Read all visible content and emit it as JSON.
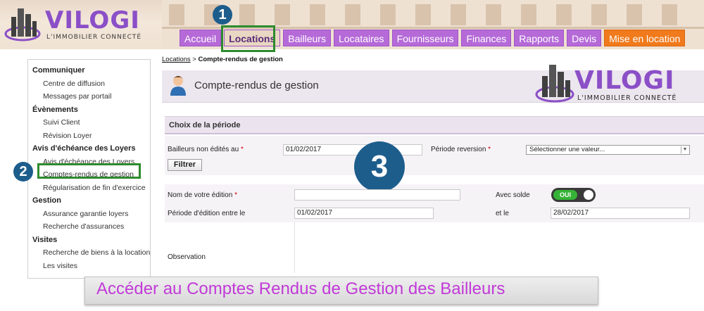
{
  "header": {
    "logo": {
      "name": "VILOGI",
      "tagline": "L'IMMOBILIER CONNECTÉ"
    },
    "nav": [
      {
        "label": "Accueil",
        "state": "normal"
      },
      {
        "label": "Locations",
        "state": "active"
      },
      {
        "label": "Bailleurs",
        "state": "normal"
      },
      {
        "label": "Locataires",
        "state": "normal"
      },
      {
        "label": "Fournisseurs",
        "state": "normal"
      },
      {
        "label": "Finances",
        "state": "normal"
      },
      {
        "label": "Rapports",
        "state": "normal"
      },
      {
        "label": "Devis",
        "state": "normal"
      },
      {
        "label": "Mise en location",
        "state": "highlight"
      }
    ]
  },
  "badges": {
    "one": "1",
    "two": "2",
    "three": "3"
  },
  "sidebar": {
    "sections": [
      {
        "title": "Communiquer",
        "items": [
          "Centre de diffusion",
          "Messages par portail"
        ]
      },
      {
        "title": "Évènements",
        "items": [
          "Suivi Client",
          "Révision Loyer"
        ]
      },
      {
        "title": "Avis d'échéance des Loyers",
        "items": [
          "Avis d'échéance des Loyers",
          "Comptes-rendus de gestion",
          "Régularisation de fin d'exercice"
        ]
      },
      {
        "title": "Gestion",
        "items": [
          "Assurance garantie loyers",
          "Recherche d'assurances"
        ]
      },
      {
        "title": "Visites",
        "items": [
          "Recherche de biens à la location",
          "Les visites"
        ]
      }
    ]
  },
  "breadcrumb": {
    "parent": "Locations",
    "separator": " > ",
    "current": "Compte-rendus de gestion"
  },
  "panel": {
    "title": "Compte-rendus de gestion"
  },
  "logo2": {
    "name": "VILOGI",
    "tagline": "L'IMMOBILIER CONNECTÉ"
  },
  "period": {
    "heading": "Choix de la période",
    "bailleurs_label": "Bailleurs non édités au",
    "bailleurs_value": "01/02/2017",
    "reversion_label": "Période reversion",
    "reversion_value": "Sélectionner une valeur...",
    "filter_button": "Filtrer"
  },
  "edition": {
    "name_label": "Nom de votre édition",
    "name_value": "",
    "solde_label": "Avec solde",
    "solde_toggle": "OUI",
    "period_label": "Période d'édition entre le",
    "period_start": "01/02/2017",
    "and_label": "et le",
    "period_end": "28/02/2017",
    "observation_label": "Observation"
  },
  "required_mark": "*",
  "banner": {
    "text": "Accéder au Comptes Rendus de Gestion des Bailleurs"
  },
  "colors": {
    "nav_purple": "#b56ad8",
    "nav_orange": "#f07a1c",
    "highlight_green": "#2e8b2e",
    "badge_blue": "#1d5d8c",
    "banner_text": "#c23ad8"
  }
}
